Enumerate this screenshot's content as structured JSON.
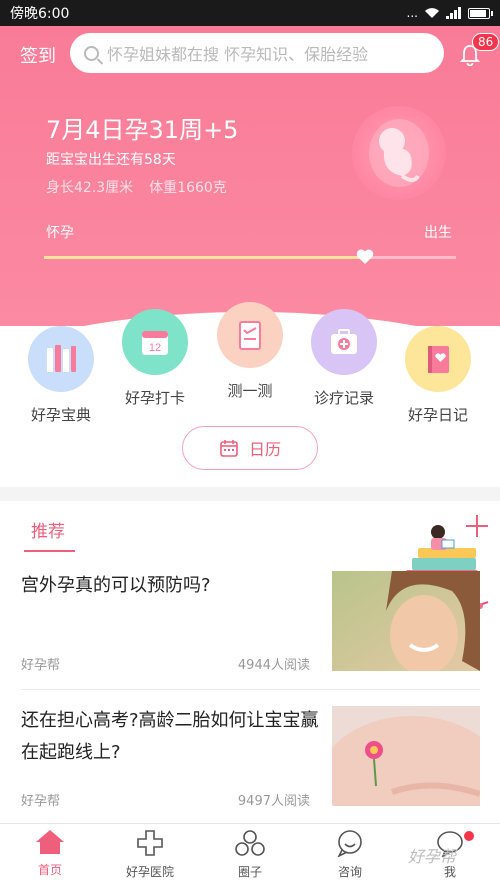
{
  "status_bar": {
    "time": "傍晚6:00",
    "network": "...",
    "signal": "ıl"
  },
  "header": {
    "signin_label": "签到",
    "search_placeholder": "怀孕姐妹都在搜 怀孕知识、保胎经验",
    "notification_count": "86"
  },
  "pregnancy": {
    "date_line": "7月4日孕31周+5",
    "countdown": "距宝宝出生还有58天",
    "length": "身长42.3厘米",
    "weight": "体重1660克",
    "progress_start_label": "怀孕",
    "progress_end_label": "出生",
    "progress_fraction": 0.779
  },
  "shortcuts": [
    {
      "label": "好孕宝典",
      "icon": "books-icon",
      "color": "#c9defa"
    },
    {
      "label": "好孕打卡",
      "icon": "calendar-checkin-icon",
      "color": "#7fe3c9"
    },
    {
      "label": "测一测",
      "icon": "test-clipboard-icon",
      "color": "#fbd1c1"
    },
    {
      "label": "诊疗记录",
      "icon": "medical-kit-icon",
      "color": "#d9c4f6"
    },
    {
      "label": "好孕日记",
      "icon": "diary-icon",
      "color": "#fde59a"
    }
  ],
  "calendar_button": {
    "label": "日历"
  },
  "feed": {
    "tab_label": "推荐",
    "articles": [
      {
        "title": "宫外孕真的可以预防吗?",
        "source": "好孕帮",
        "reads": "4944人阅读"
      },
      {
        "title": "还在担心高考?高龄二胎如何让宝宝赢在起跑线上?",
        "source": "好孕帮",
        "reads": "9497人阅读"
      }
    ]
  },
  "bottom_nav": [
    {
      "label": "首页",
      "icon": "home-icon",
      "active": true
    },
    {
      "label": "好孕医院",
      "icon": "hospital-cross-icon",
      "active": false
    },
    {
      "label": "圈子",
      "icon": "circles-icon",
      "active": false
    },
    {
      "label": "咨询",
      "icon": "consult-smile-icon",
      "active": false
    },
    {
      "label": "我",
      "icon": "me-chat-icon",
      "active": false
    }
  ],
  "watermark": "好孕帮",
  "colors": {
    "brand_pink": "#ee5f7c",
    "hero_pink": "#f97b97",
    "progress_fill": "#fde49a",
    "badge_red": "#f3344a"
  }
}
